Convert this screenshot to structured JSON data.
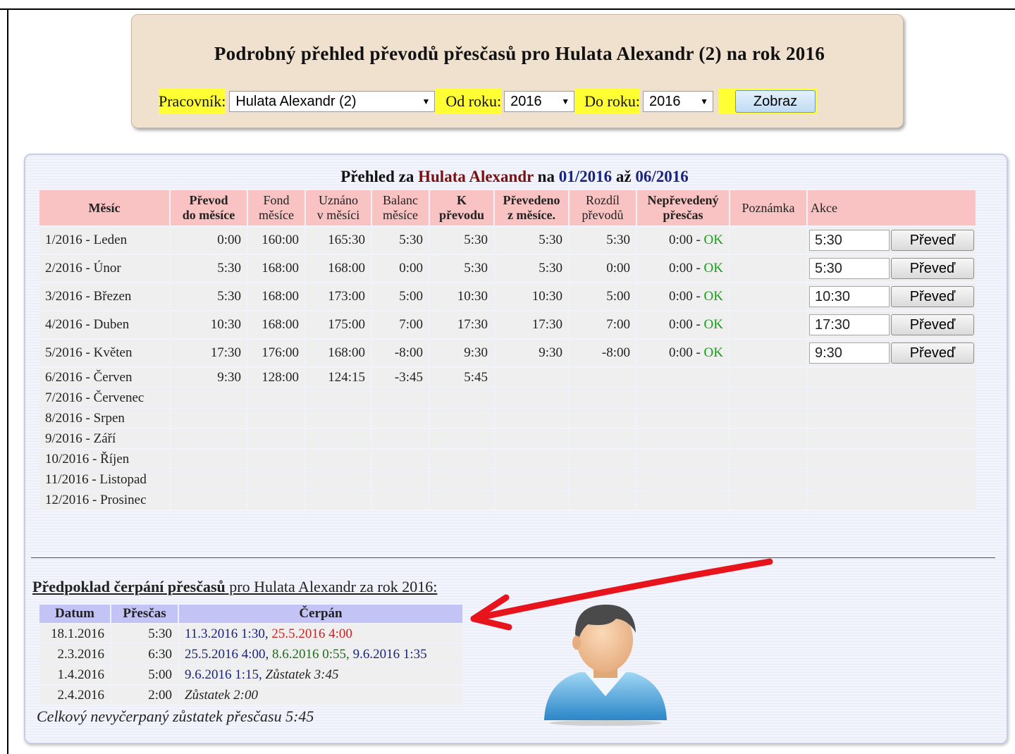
{
  "header": {
    "title": "Podrobný přehled převodů přesčasů pro Hulata Alexandr (2) na rok 2016",
    "worker_label": "Pracovník:",
    "worker_value": "Hulata Alexandr (2)",
    "from_label": "Od roku:",
    "from_value": "2016",
    "to_label": "Do roku:",
    "to_value": "2016",
    "show_button": "Zobraz"
  },
  "overview": {
    "title_prefix": "Přehled za",
    "name": "Hulata Alexandr",
    "na": "na",
    "from": "01/2016",
    "az": "až",
    "to": "06/2016",
    "columns": {
      "mesic": "Měsíc",
      "prevod_1": "Převod",
      "prevod_2": "do měsíce",
      "fond_1": "Fond",
      "fond_2": "měsíce",
      "uznano_1": "Uznáno",
      "uznano_2": "v měsíci",
      "balanc_1": "Balanc",
      "balanc_2": "měsíce",
      "k_1": "K",
      "k_2": "převodu",
      "prevedeno_1": "Převedeno",
      "prevedeno_2": "z měsíce.",
      "rozdil_1": "Rozdíl",
      "rozdil_2": "převodů",
      "neprevedeny_1": "Nepřevedený",
      "neprevedeny_2": "přesčas",
      "poznamka": "Poznámka",
      "akce": "Akce"
    },
    "rows": [
      {
        "month": "1/2016 - Leden",
        "prevod": "0:00",
        "fond": "160:00",
        "uznano": "165:30",
        "balanc": "5:30",
        "k": "5:30",
        "prevedeno": "5:30",
        "rozdil": "5:30",
        "neprevedeny": "0:00 - ",
        "ok": "OK",
        "akce": "5:30",
        "btn": "Převeď"
      },
      {
        "month": "2/2016 - Únor",
        "prevod": "5:30",
        "fond": "168:00",
        "uznano": "168:00",
        "balanc": "0:00",
        "k": "5:30",
        "prevedeno": "5:30",
        "rozdil": "0:00",
        "neprevedeny": "0:00 - ",
        "ok": "OK",
        "akce": "5:30",
        "btn": "Převeď"
      },
      {
        "month": "3/2016 - Březen",
        "prevod": "5:30",
        "fond": "168:00",
        "uznano": "173:00",
        "balanc": "5:00",
        "k": "10:30",
        "prevedeno": "10:30",
        "rozdil": "5:00",
        "neprevedeny": "0:00 - ",
        "ok": "OK",
        "akce": "10:30",
        "btn": "Převeď"
      },
      {
        "month": "4/2016 - Duben",
        "prevod": "10:30",
        "fond": "168:00",
        "uznano": "175:00",
        "balanc": "7:00",
        "k": "17:30",
        "prevedeno": "17:30",
        "rozdil": "7:00",
        "neprevedeny": "0:00 - ",
        "ok": "OK",
        "akce": "17:30",
        "btn": "Převeď"
      },
      {
        "month": "5/2016 - Květen",
        "prevod": "17:30",
        "fond": "176:00",
        "uznano": "168:00",
        "balanc": "-8:00",
        "k": "9:30",
        "prevedeno": "9:30",
        "rozdil": "-8:00",
        "neprevedeny": "0:00 - ",
        "ok": "OK",
        "akce": "9:30",
        "btn": "Převeď"
      },
      {
        "month": "6/2016 - Červen",
        "prevod": "9:30",
        "fond": "128:00",
        "uznano": "124:15",
        "balanc": "-3:45",
        "k": "5:45"
      },
      {
        "month": "7/2016 - Červenec"
      },
      {
        "month": "8/2016 - Srpen"
      },
      {
        "month": "9/2016 - Září"
      },
      {
        "month": "10/2016 - Říjen"
      },
      {
        "month": "11/2016 - Listopad"
      },
      {
        "month": "12/2016 - Prosinec"
      }
    ]
  },
  "estimate": {
    "title_bold": "Předpoklad čerpání přesčasů",
    "title_rest": " pro Hulata Alexandr za rok 2016:",
    "columns": {
      "datum": "Datum",
      "prescas": "Přesčas",
      "cerpan": "Čerpán"
    },
    "rows": [
      {
        "datum": "18.1.2016",
        "prescas": "5:30",
        "c1": "11.3.2016 1:30, ",
        "c2": "25.5.2016 4:00"
      },
      {
        "datum": "2.3.2016",
        "prescas": "6:30",
        "c1": "25.5.2016 4:00, ",
        "c2": "8.6.2016 0:55, ",
        "c3": "9.6.2016 1:35"
      },
      {
        "datum": "1.4.2016",
        "prescas": "5:00",
        "c1": "9.6.2016 1:15, ",
        "c2": "Zůstatek 3:45"
      },
      {
        "datum": "2.4.2016",
        "prescas": "2:00",
        "c1": "Zůstatek 2:00"
      }
    ],
    "total": "Celkový nevyčerpaný zůstatek přesčasu 5:45"
  },
  "colors": {
    "accent_red": "#e8141c",
    "header_pink": "#f9c3c3",
    "header_lilac": "#c3c3f5",
    "label_yellow": "#ffff33"
  },
  "icons": [
    "red-arrow-icon",
    "user-avatar-icon",
    "dropdown-arrow-icon"
  ]
}
